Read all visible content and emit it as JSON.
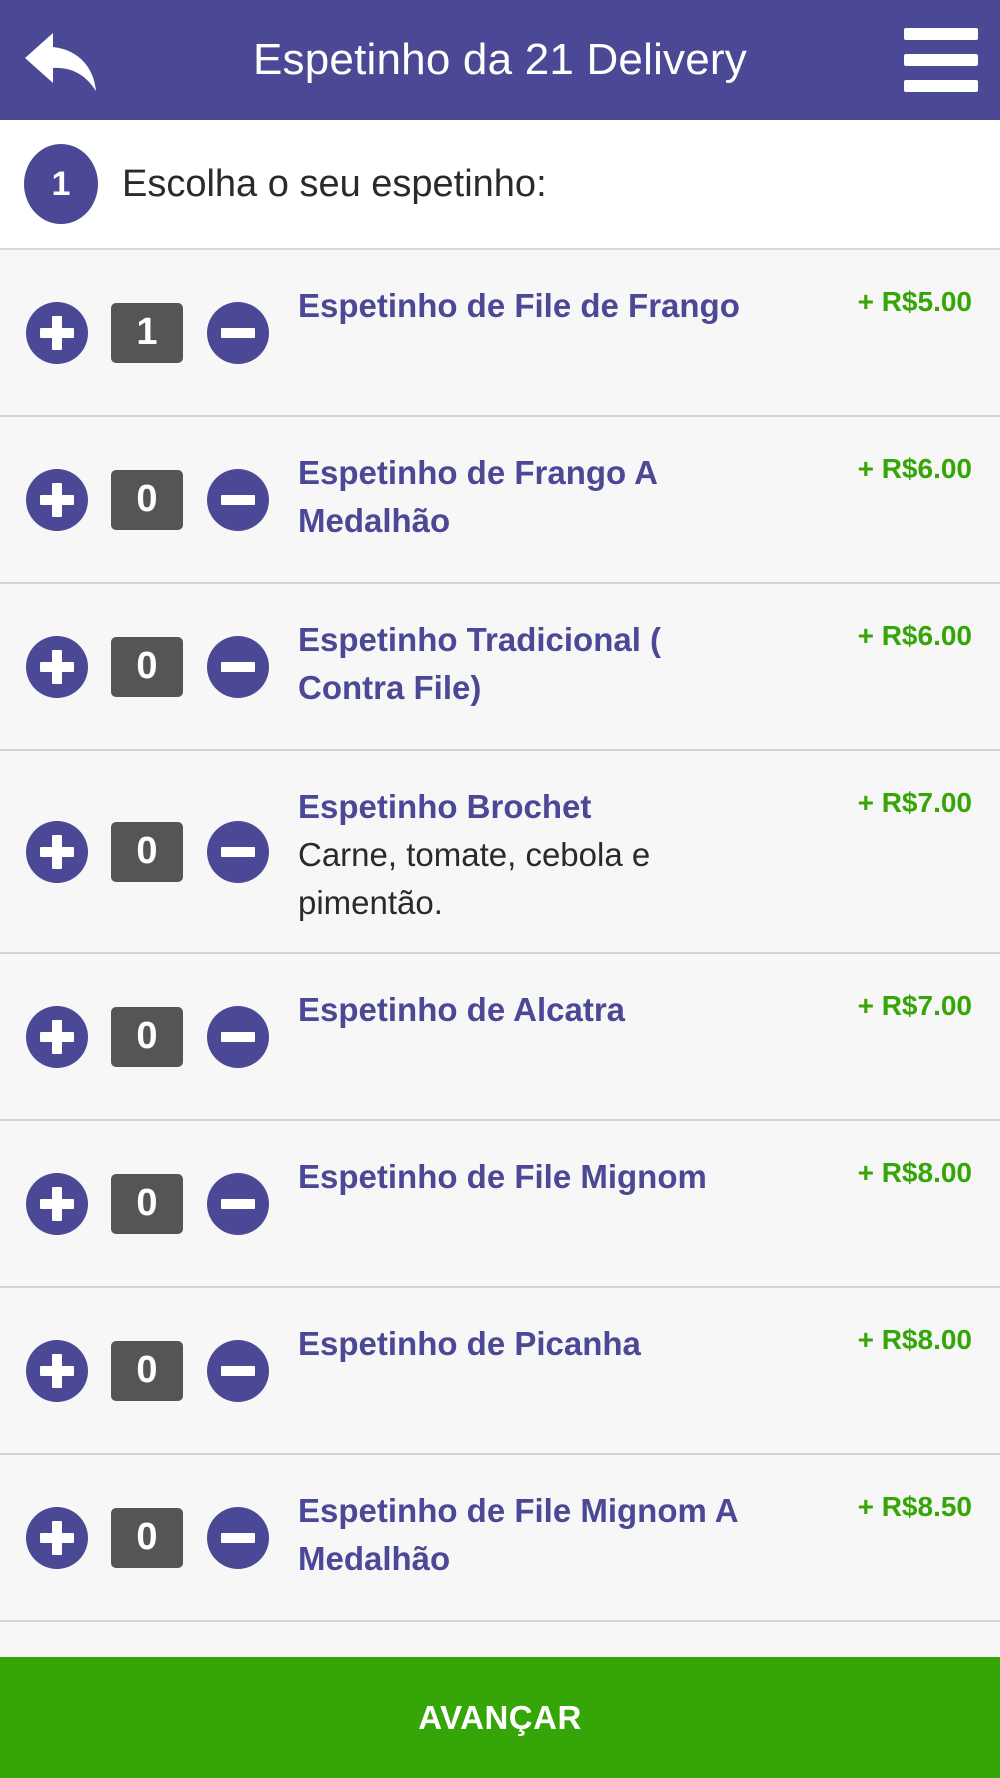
{
  "header": {
    "title": "Espetinho da 21 Delivery",
    "back_icon": "reply-arrow-icon",
    "menu_icon": "hamburger-menu-icon"
  },
  "step": {
    "number": "1",
    "label": "Escolha o seu espetinho:"
  },
  "items": [
    {
      "quantity": "1",
      "name": "Espetinho de File de Frango",
      "description": "",
      "price": "+ R$5.00"
    },
    {
      "quantity": "0",
      "name": "Espetinho de Frango A Medalhão",
      "description": "",
      "price": "+ R$6.00"
    },
    {
      "quantity": "0",
      "name": "Espetinho Tradicional ( Contra File)",
      "description": "",
      "price": "+ R$6.00"
    },
    {
      "quantity": "0",
      "name": "Espetinho Brochet",
      "description": "Carne, tomate, cebola e pimentão.",
      "price": "+ R$7.00"
    },
    {
      "quantity": "0",
      "name": "Espetinho de Alcatra",
      "description": "",
      "price": "+ R$7.00"
    },
    {
      "quantity": "0",
      "name": "Espetinho de File Mignom",
      "description": "",
      "price": "+ R$8.00"
    },
    {
      "quantity": "0",
      "name": "Espetinho de Picanha",
      "description": "",
      "price": "+ R$8.00"
    },
    {
      "quantity": "0",
      "name": "Espetinho de File Mignom A Medalhão",
      "description": "",
      "price": "+ R$8.50"
    }
  ],
  "footer": {
    "advance_label": "AVANÇAR"
  },
  "colors": {
    "primary": "#4b4895",
    "price_green": "#35a507",
    "qty_box": "#555555"
  }
}
